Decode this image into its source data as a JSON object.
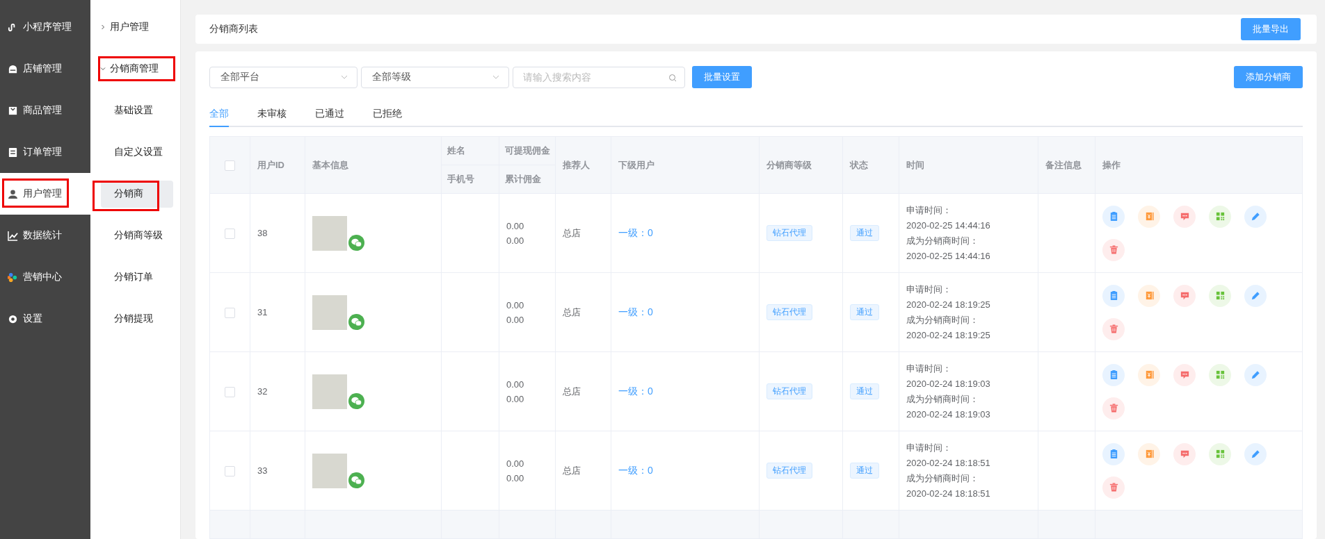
{
  "sidebar": {
    "items": [
      {
        "label": "小程序管理",
        "selected": false,
        "annotated": false
      },
      {
        "label": "店铺管理",
        "selected": false,
        "annotated": false
      },
      {
        "label": "商品管理",
        "selected": false,
        "annotated": false
      },
      {
        "label": "订单管理",
        "selected": false,
        "annotated": false
      },
      {
        "label": "用户管理",
        "selected": true,
        "annotated": true
      },
      {
        "label": "数据统计",
        "selected": false,
        "annotated": false
      },
      {
        "label": "营销中心",
        "selected": false,
        "annotated": false
      },
      {
        "label": "设置",
        "selected": false,
        "annotated": false
      }
    ]
  },
  "submenu": {
    "items": [
      {
        "label": "用户管理",
        "expanded": false,
        "annotated": false
      },
      {
        "label": "分销商管理",
        "expanded": true,
        "annotated": true,
        "children": [
          {
            "label": "基础设置",
            "selected": false,
            "annotated": false
          },
          {
            "label": "自定义设置",
            "selected": false,
            "annotated": false
          },
          {
            "label": "分销商",
            "selected": true,
            "annotated": true
          },
          {
            "label": "分销商等级",
            "selected": false,
            "annotated": false
          },
          {
            "label": "分销订单",
            "selected": false,
            "annotated": false
          },
          {
            "label": "分销提现",
            "selected": false,
            "annotated": false
          }
        ]
      }
    ]
  },
  "header": {
    "title": "分销商列表",
    "export_button": "批量导出"
  },
  "filters": {
    "platform": "全部平台",
    "level": "全部等级",
    "search": {
      "placeholder": "请输入搜索内容"
    },
    "batch_button": "批量设置",
    "add_button": "添加分销商"
  },
  "tabs": [
    {
      "label": "全部",
      "selected": true
    },
    {
      "label": "未审核",
      "selected": false
    },
    {
      "label": "已通过",
      "selected": false
    },
    {
      "label": "已拒绝",
      "selected": false
    }
  ],
  "table": {
    "select_all_checked": false,
    "columns": {
      "user_id": "用户ID",
      "basic_info": "基本信息",
      "name": "姓名",
      "phone": "手机号",
      "withdrawable": "可提现佣金",
      "total": "累计佣金",
      "referrer": "推荐人",
      "subordinates": "下级用户",
      "level": "分销商等级",
      "status": "状态",
      "time": "时间",
      "remark": "备注信息",
      "actions": "操作"
    },
    "actions": [
      {
        "kind": "clipboard",
        "color": "#409eff"
      },
      {
        "kind": "ledger",
        "color": "#ff9a3c"
      },
      {
        "kind": "message",
        "color": "#f56c6c"
      },
      {
        "kind": "qrcode",
        "color": "#67c23a"
      },
      {
        "kind": "edit",
        "color": "#409eff"
      },
      {
        "kind": "delete",
        "color": "#f56c6c"
      }
    ],
    "rows": [
      {
        "checked": false,
        "user_id": "38",
        "withdrawable": "0.00",
        "total": "0.00",
        "referrer": "总店",
        "subordinates": "一级：0",
        "level": "钻石代理",
        "status": "通过",
        "apply_label": "申请时间：",
        "apply_time": "2020-02-25 14:44:16",
        "become_label": "成为分销商时间：",
        "become_time": "2020-02-25 14:44:16"
      },
      {
        "checked": false,
        "user_id": "31",
        "withdrawable": "0.00",
        "total": "0.00",
        "referrer": "总店",
        "subordinates": "一级：0",
        "level": "钻石代理",
        "status": "通过",
        "apply_label": "申请时间：",
        "apply_time": "2020-02-24 18:19:25",
        "become_label": "成为分销商时间：",
        "become_time": "2020-02-24 18:19:25"
      },
      {
        "checked": false,
        "user_id": "32",
        "withdrawable": "0.00",
        "total": "0.00",
        "referrer": "总店",
        "subordinates": "一级：0",
        "level": "钻石代理",
        "status": "通过",
        "apply_label": "申请时间：",
        "apply_time": "2020-02-24 18:19:03",
        "become_label": "成为分销商时间：",
        "become_time": "2020-02-24 18:19:03"
      },
      {
        "checked": false,
        "user_id": "33",
        "withdrawable": "0.00",
        "total": "0.00",
        "referrer": "总店",
        "subordinates": "一级：0",
        "level": "钻石代理",
        "status": "通过",
        "apply_label": "申请时间：",
        "apply_time": "2020-02-24 18:18:51",
        "become_label": "成为分销商时间：",
        "become_time": "2020-02-24 18:18:51"
      }
    ]
  }
}
